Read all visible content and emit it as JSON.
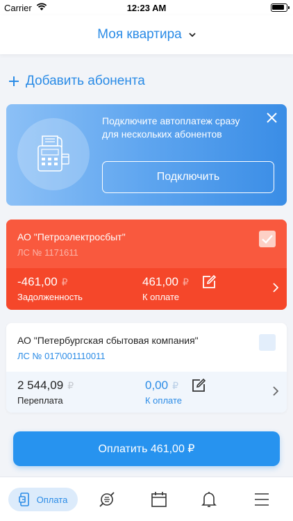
{
  "status_bar": {
    "carrier": "Carrier",
    "time": "12:23 AM"
  },
  "header": {
    "title": "Моя квартира"
  },
  "add_subscriber": {
    "label": "Добавить абонента"
  },
  "promo": {
    "text": "Подключите автоплатеж сразу для нескольких абонентов",
    "button_label": "Подключить"
  },
  "accounts": [
    {
      "name": "АО \"Петроэлектросбыт\"",
      "account": "ЛС № 1171611",
      "balance": "-461,00",
      "balance_label": "Задолженность",
      "to_pay": "461,00",
      "to_pay_label": "К оплате",
      "currency": "₽",
      "selected": true
    },
    {
      "name": "АО \"Петербургская сбытовая компания\"",
      "account": "ЛС № 017\\001110011",
      "balance": "2 544,09",
      "balance_label": "Переплата",
      "to_pay": "0,00",
      "to_pay_label": "К оплате",
      "currency": "₽",
      "selected": false
    }
  ],
  "pay_button": {
    "label": "Оплатить 461,00 ₽"
  },
  "tabbar": {
    "active_label": "Оплата"
  },
  "colors": {
    "accent": "#2a8be6",
    "debt": "#f5472a"
  }
}
